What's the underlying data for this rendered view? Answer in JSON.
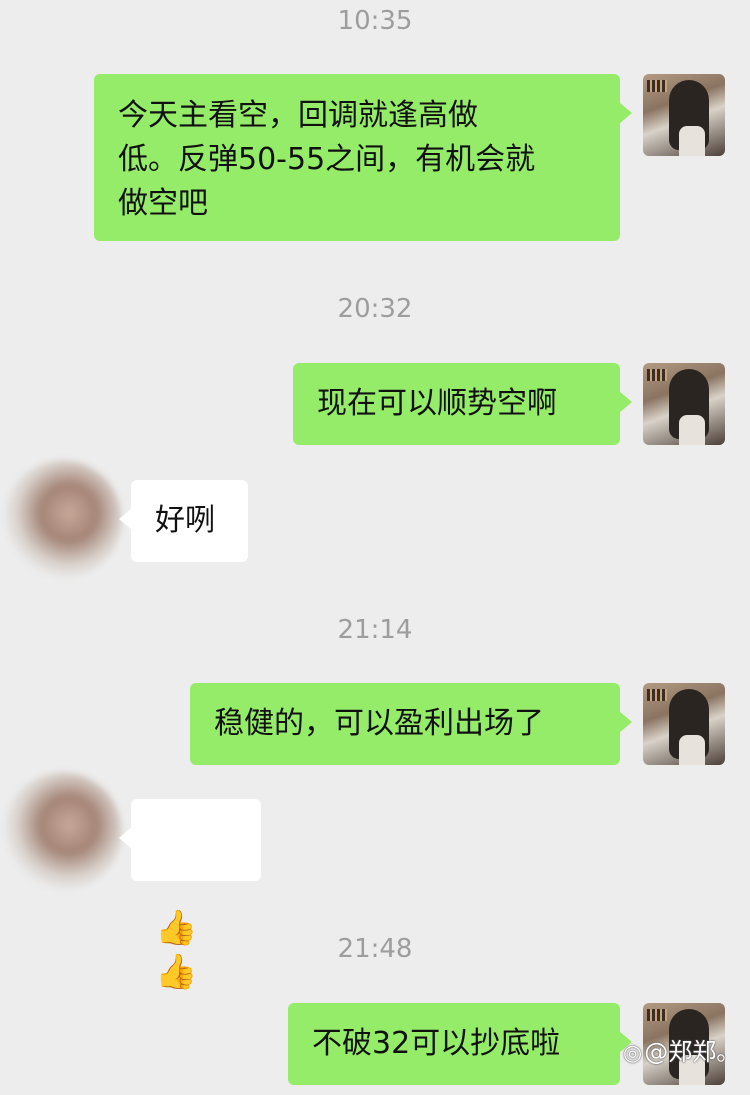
{
  "messages": [
    {
      "time": "10:35"
    },
    {
      "text": "今天主看空，回调就逢高做\n低。反弹50-55之间，有机会就\n做空吧"
    },
    {
      "time": "20:32"
    },
    {
      "text": "现在可以顺势空啊"
    },
    {
      "text": "好咧"
    },
    {
      "time": "21:14"
    },
    {
      "text": "稳健的，可以盈利出场了"
    },
    {
      "text": "👍👍"
    },
    {
      "time": "21:48"
    },
    {
      "text": "不破32可以抄底啦"
    }
  ],
  "watermark": {
    "icon": "weibo-icon",
    "text": "@郑郑。"
  },
  "colors": {
    "background": "#ededed",
    "my_bubble": "#95ec69",
    "other_bubble": "#ffffff",
    "timestamp": "#9d9d9d"
  }
}
